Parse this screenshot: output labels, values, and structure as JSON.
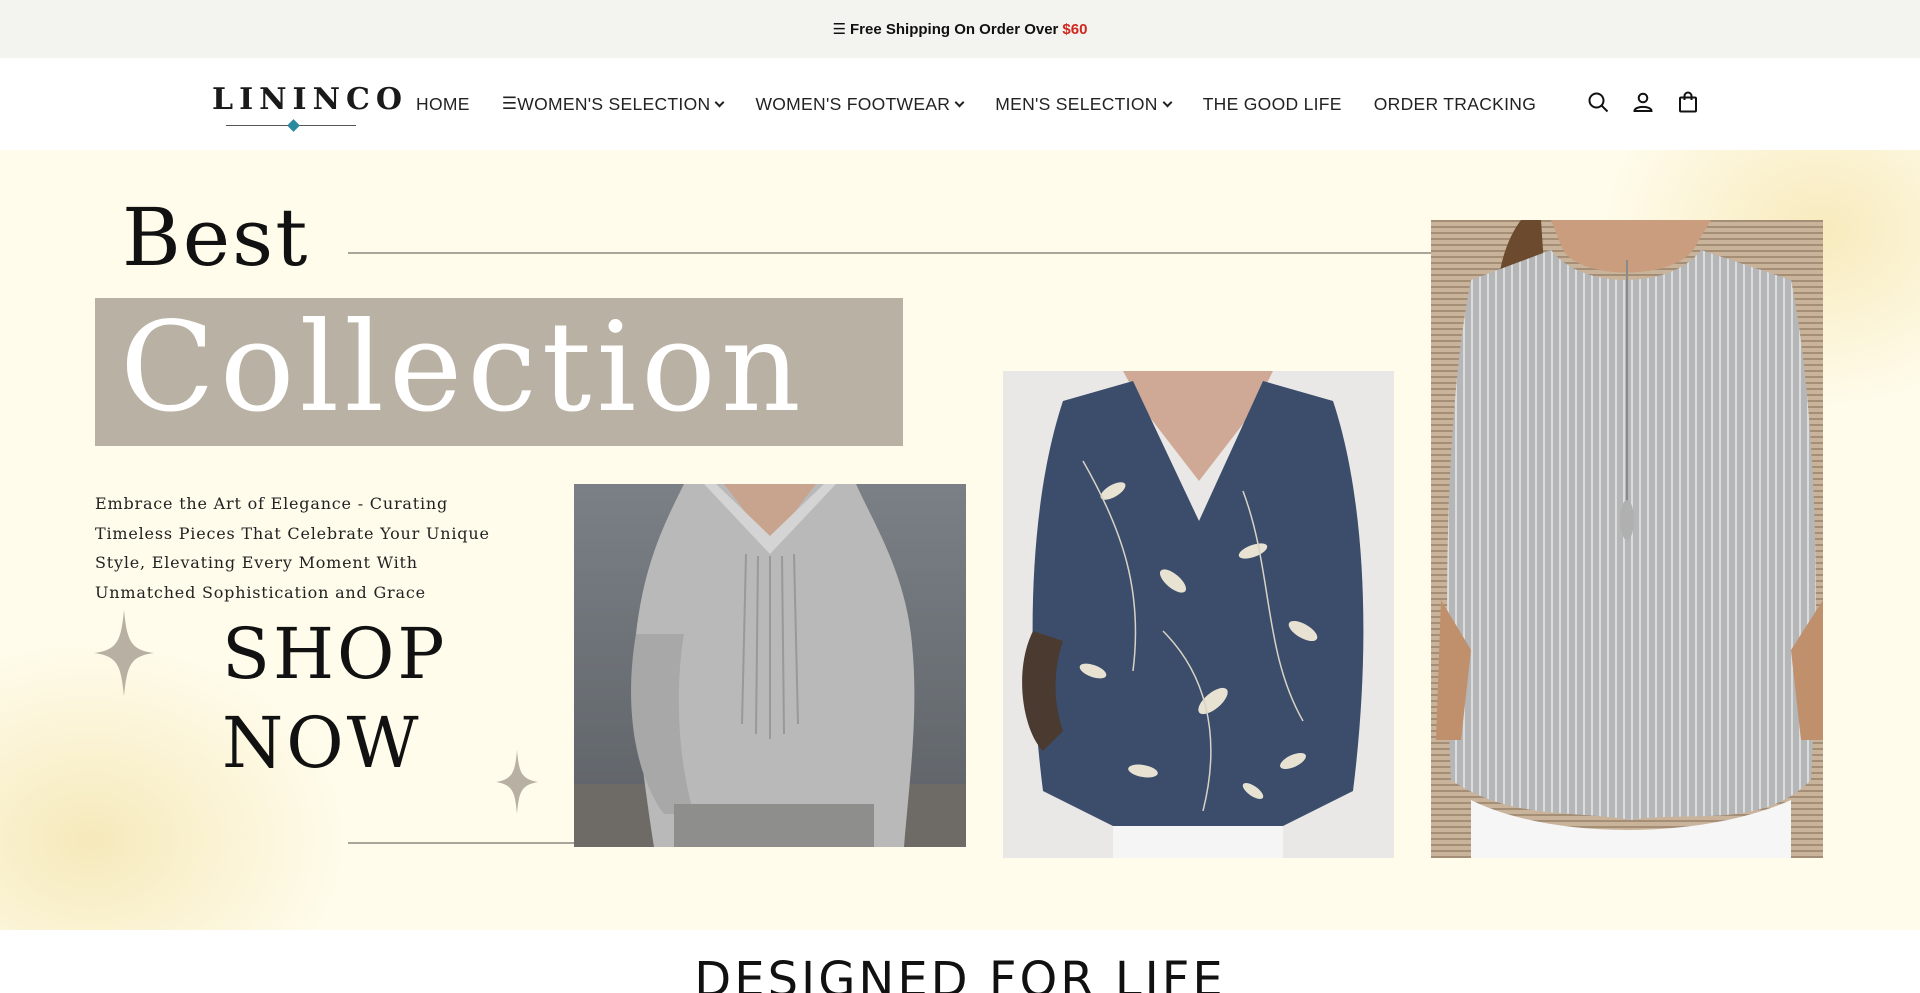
{
  "announcement": {
    "icon": "menu-icon",
    "text": "Free Shipping On Order Over",
    "price": "$60",
    "price_color": "#d0261d"
  },
  "header": {
    "logo_text": "LININCO",
    "logo_accent_color": "#2c8aa0",
    "nav": [
      {
        "label": "HOME",
        "has_dropdown": false
      },
      {
        "label": "WOMEN'S SELECTION",
        "has_dropdown": true,
        "icon": "menu-icon"
      },
      {
        "label": "WOMEN'S FOOTWEAR",
        "has_dropdown": true
      },
      {
        "label": "MEN'S SELECTION",
        "has_dropdown": true
      },
      {
        "label": "THE GOOD LIFE",
        "has_dropdown": false
      },
      {
        "label": "ORDER TRACKING",
        "has_dropdown": false
      }
    ],
    "icons": [
      "search-icon",
      "account-icon",
      "cart-icon"
    ]
  },
  "hero": {
    "line1": "Best",
    "line2": "Collection",
    "blurb": "Embrace the Art of Elegance - Curating Timeless Pieces That Celebrate Your Unique Style, Elevating Every Moment With Unmatched Sophistication and Grace",
    "cta_line1": "SHOP",
    "cta_line2": "NOW",
    "background_color": "#fffcec",
    "band_color": "#b9b1a3",
    "images": [
      "pleated-gray-blouse-photo",
      "navy-floral-shirt-photo",
      "striped-gray-tunic-photo"
    ]
  },
  "next_section": {
    "heading": "DESIGNED FOR LIFE"
  }
}
